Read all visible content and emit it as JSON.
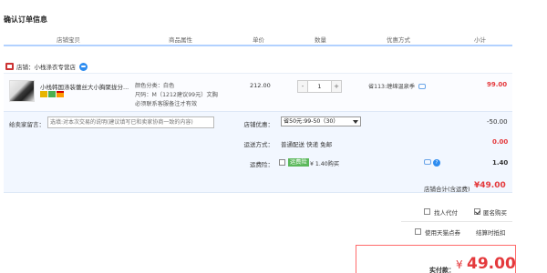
{
  "page_title": "确认订单信息",
  "headers": [
    "店铺宝贝",
    "商品属性",
    "单价",
    "数量",
    "优惠方式",
    "小计"
  ],
  "shop": {
    "label": "店铺：",
    "name": "小栈涤衣专营店"
  },
  "item": {
    "title": "小栈韩国涤装蕾丝大小胸聚拢分...",
    "attr_color": "颜色分类：白色",
    "attr_size": "尺码：M（1212建议99元）文胸",
    "attr_note": "必须联系客服备注才有效",
    "price": "212.00",
    "qty_minus": "-",
    "qty_value": "1",
    "qty_plus": "+",
    "promo": "省113:缠绵温泉季",
    "subtotal": "99.00"
  },
  "message": {
    "label": "给卖家留言：",
    "placeholder": "选填:对本次交易的说明(建议填写已和卖家协商一致的内容)"
  },
  "coupon": {
    "label": "店铺优惠：",
    "selected": "省50元:99-50（30）",
    "discount": "-50.00"
  },
  "shipping": {
    "label": "运送方式：",
    "info": "普通配送 快递 免邮",
    "price": "0.00"
  },
  "insurance": {
    "label": "运费险：",
    "tag": "运费险",
    "text": "¥ 1.40购买",
    "price": "1.40"
  },
  "shop_total": {
    "label": "店铺合计(含运费)",
    "value": "¥49.00"
  },
  "options": {
    "proxy_pay": "找人代付",
    "anonymous": "匿名购买",
    "tmall_points": "使用天猫点券",
    "installment": "结算时抵扣"
  },
  "pay": {
    "label": "实付款：",
    "symbol": "¥",
    "amount": "49.00"
  }
}
